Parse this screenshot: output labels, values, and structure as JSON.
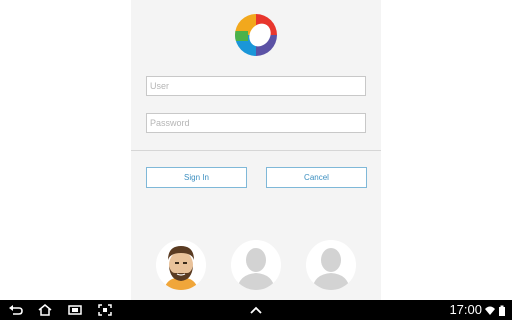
{
  "login": {
    "user_placeholder": "User",
    "password_placeholder": "Password",
    "signin_label": "Sign In",
    "cancel_label": "Cancel"
  },
  "avatars": [
    "bearded-man-avatar",
    "default-avatar",
    "default-avatar"
  ],
  "navbar": {
    "time": "17:00",
    "icons": [
      "back-icon",
      "home-icon",
      "recent-apps-icon",
      "screenshot-icon",
      "chevron-up-icon",
      "wifi-icon",
      "battery-icon"
    ]
  },
  "colors": {
    "accent": "#3c8fc0",
    "panel_bg": "#f4f4f4",
    "navbar_bg": "#000000"
  }
}
